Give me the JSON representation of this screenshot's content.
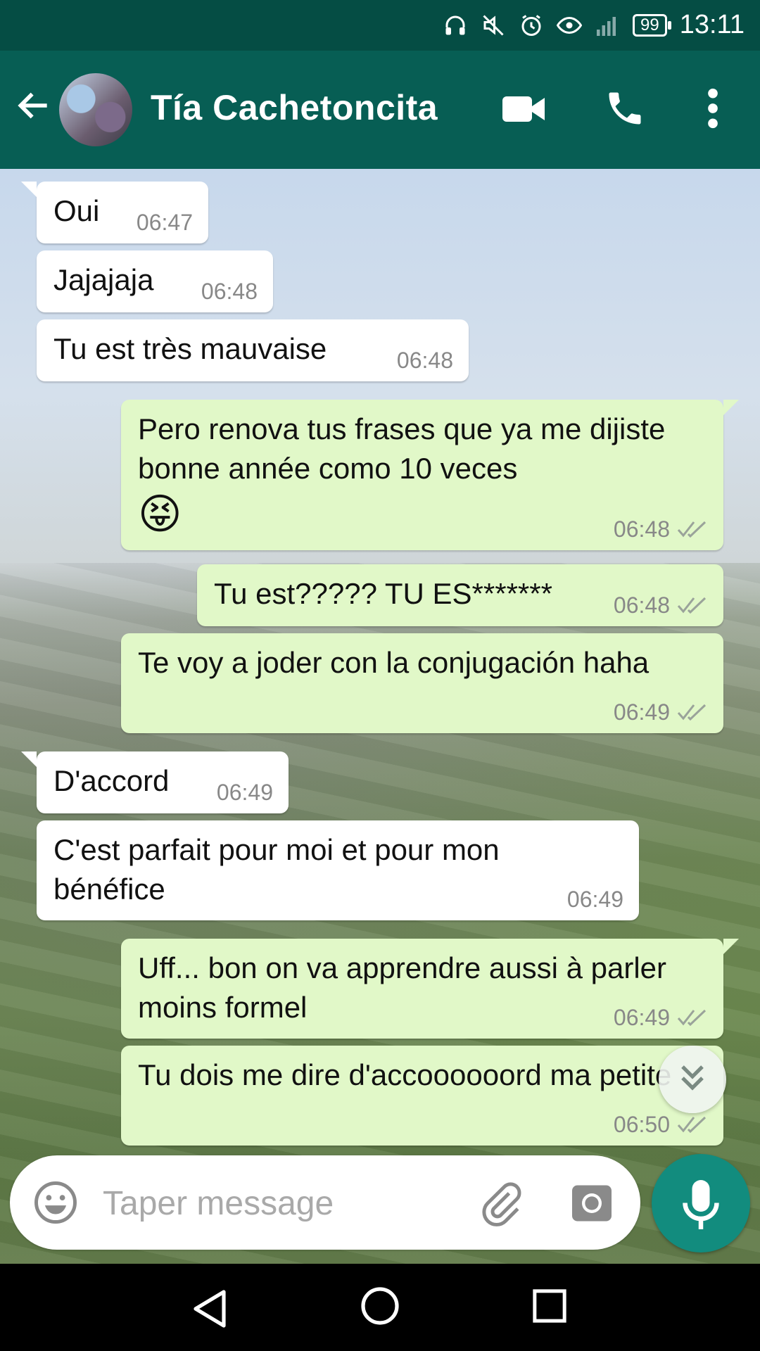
{
  "status_bar": {
    "battery": "99",
    "time": "13:11"
  },
  "header": {
    "contact_name": "Tía Cachetoncita"
  },
  "messages": [
    {
      "dir": "in",
      "text": "Oui",
      "time": "06:47"
    },
    {
      "dir": "in",
      "text": "Jajajaja",
      "time": "06:48"
    },
    {
      "dir": "in",
      "text": "Tu est très mauvaise",
      "time": "06:48"
    },
    {
      "dir": "out",
      "text": "Pero renova tus frases que ya me dijiste bonne année como 10 veces",
      "emoji": "😝",
      "time": "06:48"
    },
    {
      "dir": "out",
      "text": "Tu est????? TU ES*******",
      "time": "06:48"
    },
    {
      "dir": "out",
      "text": "Te voy a joder con la conjugación haha",
      "time": "06:49"
    },
    {
      "dir": "in",
      "text": "D'accord",
      "time": "06:49"
    },
    {
      "dir": "in",
      "text": "C'est parfait pour moi et pour mon bénéfice",
      "time": "06:49"
    },
    {
      "dir": "out",
      "text": "Uff... bon on va apprendre aussi à parler moins formel",
      "time": "06:49"
    },
    {
      "dir": "out",
      "text": "Tu dois me dire d'accoooooord ma petite",
      "time": "06:50"
    }
  ],
  "composer": {
    "placeholder": "Taper message"
  },
  "colors": {
    "header": "#075e54",
    "status_bar": "#054d44",
    "outgoing_bubble": "#e1f8c8",
    "incoming_bubble": "#ffffff",
    "mic_button": "#128c7e",
    "read_ticks": "#9aa39a"
  }
}
